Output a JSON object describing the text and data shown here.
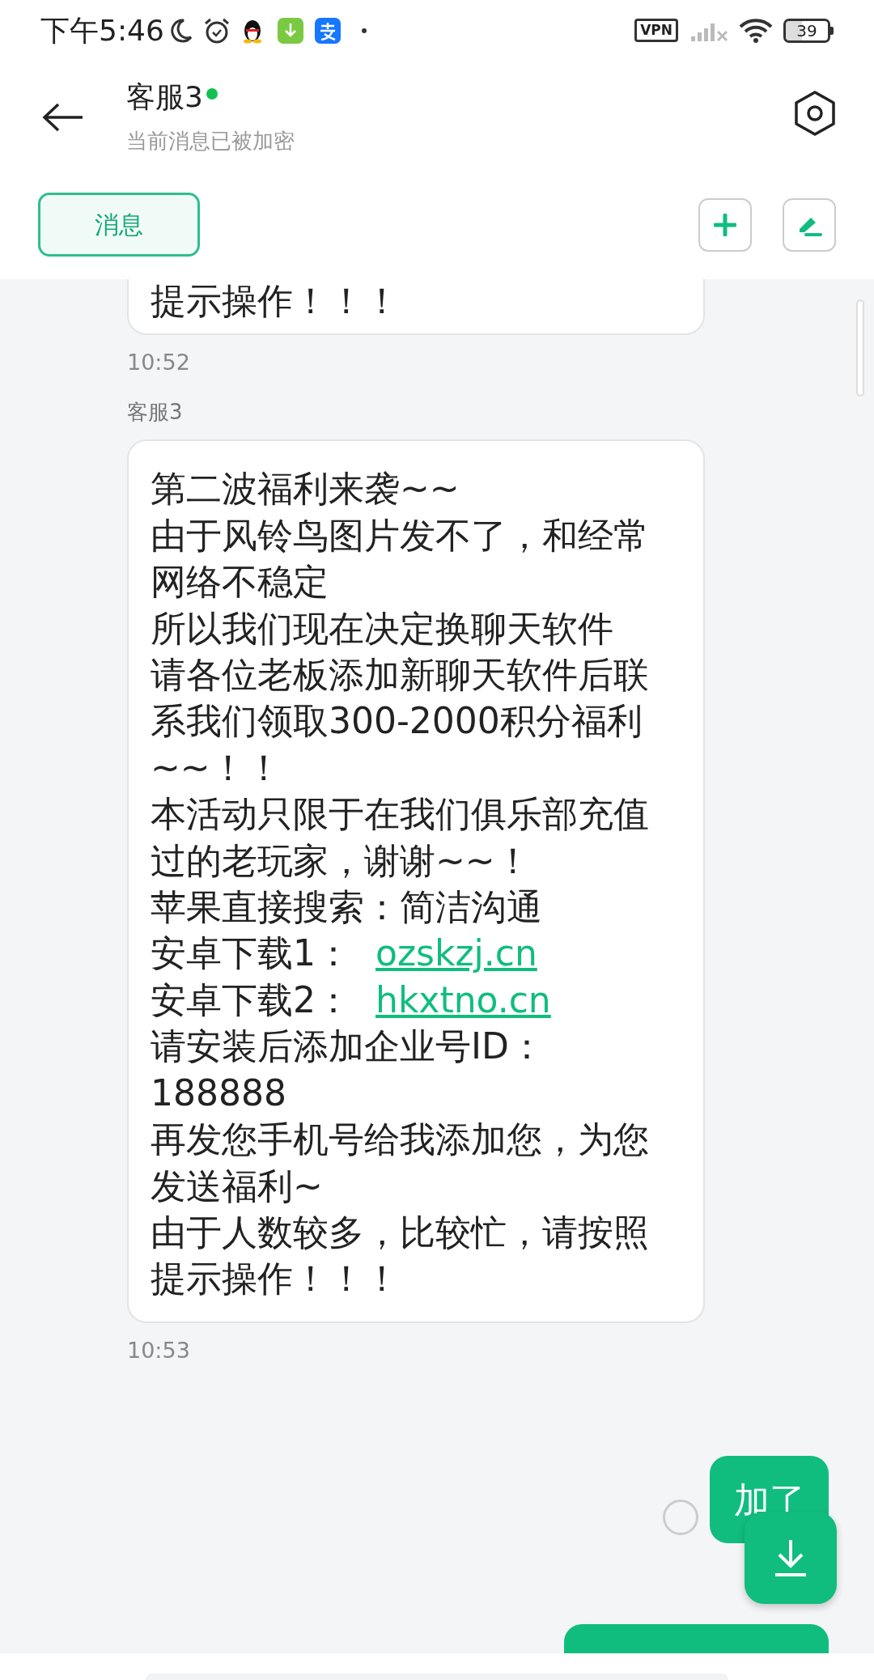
{
  "status_bar": {
    "time": "下午5:46",
    "vpn": "VPN",
    "battery": "39"
  },
  "header": {
    "title": "客服3",
    "online": true,
    "subtitle": "当前消息已被加密"
  },
  "tabs": [
    {
      "label": "消息",
      "selected": true
    }
  ],
  "messages": [
    {
      "kind": "incoming",
      "lines": [
        {
          "text": "提示操作！！！"
        }
      ],
      "time": "10:52"
    },
    {
      "kind": "incoming",
      "sender": "客服3",
      "lines": [
        {
          "text": "第二波福利来袭~~"
        },
        {
          "text": "由于风铃鸟图片发不了，和经常"
        },
        {
          "text": "网络不稳定"
        },
        {
          "text": "所以我们现在决定换聊天软件"
        },
        {
          "text": "请各位老板添加新聊天软件后联"
        },
        {
          "text": "系我们领取300-2000积分福利"
        },
        {
          "text": "~~！！"
        },
        {
          "text": "本活动只限于在我们俱乐部充值"
        },
        {
          "text": "过的老玩家，谢谢~~！"
        },
        {
          "text": "苹果直接搜索：简洁沟通"
        },
        {
          "text": "安卓下载1：",
          "link": "ozskzj.cn"
        },
        {
          "text": "安卓下载2：",
          "link": "hkxtno.cn"
        },
        {
          "text": "请安装后添加企业号ID："
        },
        {
          "text": "188888"
        },
        {
          "text": "再发您手机号给我添加您，为您"
        },
        {
          "text": "发送福利~"
        },
        {
          "text": "由于人数较多，比较忙，请按照"
        },
        {
          "text": "提示操作！！！"
        }
      ],
      "time": "10:53"
    },
    {
      "kind": "outgoing",
      "text": "加了",
      "selected": false
    },
    {
      "kind": "outgoing_cut"
    }
  ]
}
